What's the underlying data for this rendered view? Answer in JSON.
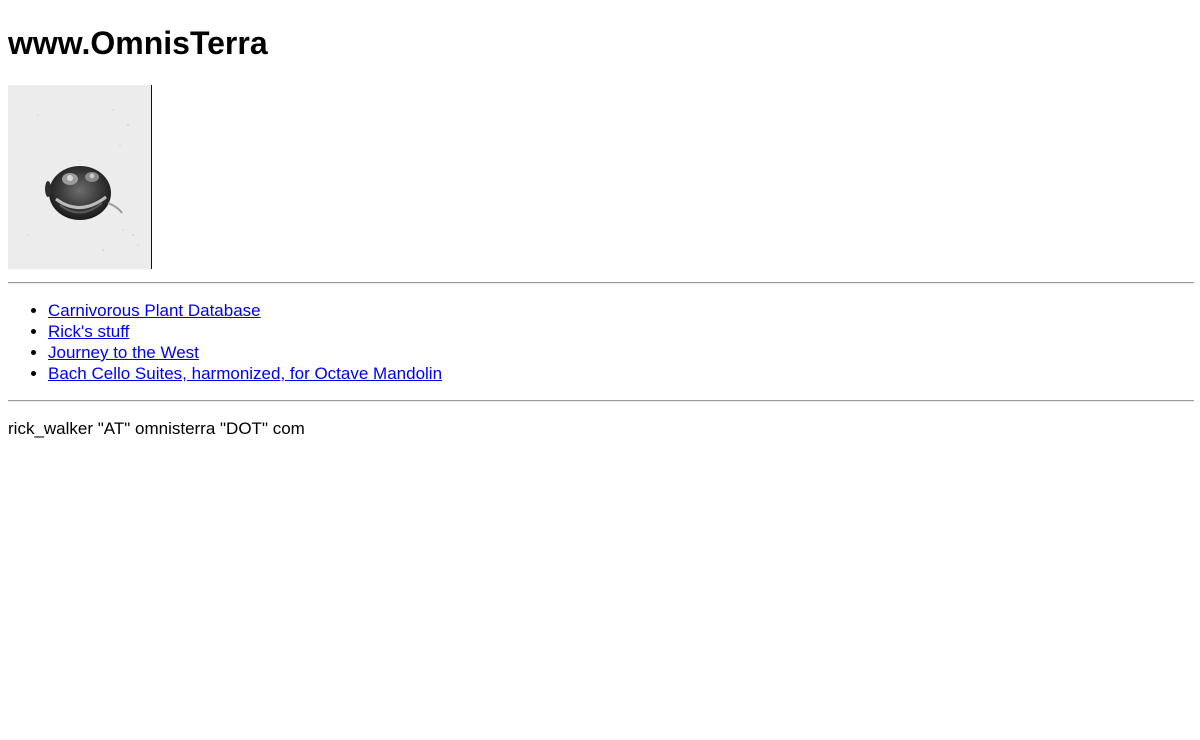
{
  "header": {
    "title": "www.OmnisTerra"
  },
  "logo": {
    "icon": "frog-face-image",
    "background": "#ececec"
  },
  "nav": {
    "items": [
      {
        "label": "Carnivorous Plant Database"
      },
      {
        "label": "Rick's stuff"
      },
      {
        "label": "Journey to the West"
      },
      {
        "label": "Bach Cello Suites, harmonized, for Octave Mandolin"
      }
    ],
    "link_color": "#0000ee"
  },
  "footer": {
    "contact": "rick_walker \"AT\" omnisterra \"DOT\" com"
  }
}
